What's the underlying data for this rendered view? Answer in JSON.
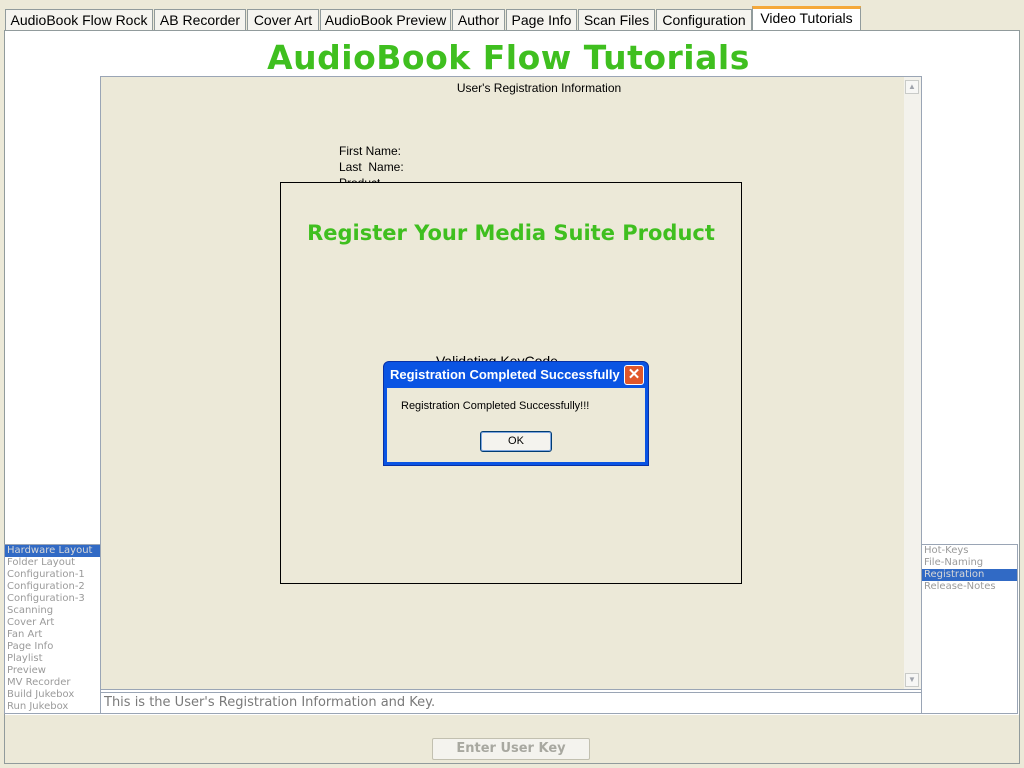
{
  "tabs": [
    {
      "label": "AudioBook Flow Rock",
      "active": false
    },
    {
      "label": "AB Recorder",
      "active": false
    },
    {
      "label": "Cover Art",
      "active": false
    },
    {
      "label": "AudioBook Preview",
      "active": false
    },
    {
      "label": "Author",
      "active": false
    },
    {
      "label": "Page Info",
      "active": false
    },
    {
      "label": "Scan Files",
      "active": false
    },
    {
      "label": "Configuration",
      "active": false
    },
    {
      "label": "Video Tutorials",
      "active": true
    }
  ],
  "page_title": "AudioBook Flow Tutorials",
  "viewer": {
    "heading": "User's Registration Information",
    "fields": [
      "First Name:",
      "Last  Name:",
      "Product"
    ],
    "register_title": "Register Your Media Suite Product",
    "validating_text": "Validating KeyCode"
  },
  "dialog": {
    "title": "Registration Completed Successfully",
    "message": "Registration Completed Successfully!!!",
    "ok_label": "OK"
  },
  "left_list": {
    "items": [
      "Hardware Layout",
      "Folder Layout",
      "Configuration-1",
      "Configuration-2",
      "Configuration-3",
      "Scanning",
      "Cover Art",
      "Fan Art",
      "Page Info",
      "Playlist",
      "Preview",
      "MV Recorder",
      "Build Jukebox",
      "Run Jukebox"
    ],
    "selected": "Hardware Layout"
  },
  "right_list": {
    "items": [
      "Hot-Keys",
      "File-Naming",
      "Registration",
      "Release-Notes"
    ],
    "selected": "Registration"
  },
  "description": "This is the User's Registration Information and Key.",
  "enter_key_button": "Enter User Key",
  "colors": {
    "title_green": "#3fbf1f",
    "selection_blue": "#316ac5",
    "dialog_blue": "#0a54e3",
    "active_tab_accent": "#f5a838"
  }
}
